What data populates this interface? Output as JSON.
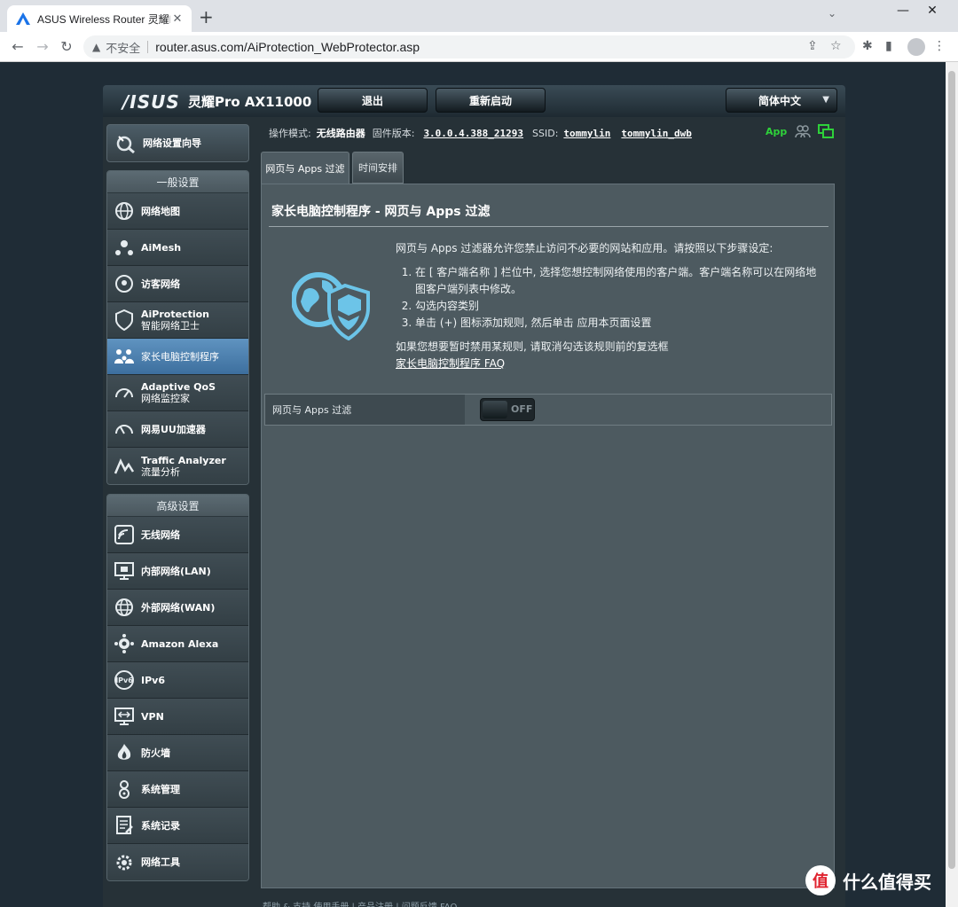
{
  "browser": {
    "tab_title": "ASUS Wireless Router 灵耀Pro",
    "tab_close": "✕",
    "new_tab": "+",
    "insecure_label": "不安全",
    "url": "router.asus.com/AiProtection_WebProtector.asp"
  },
  "header": {
    "logo": "/ISUS",
    "model": "灵耀Pro AX11000",
    "logout": "退出",
    "reboot": "重新启动",
    "language": "简体中文"
  },
  "status": {
    "mode_label": "操作模式:",
    "mode_value": "无线路由器",
    "firmware_label": "固件版本:",
    "firmware_value": "3.0.0.4.388_21293",
    "ssid_label": "SSID:",
    "ssid_1": "tommylin",
    "ssid_2": "tommylin_dwb",
    "app_label": "App"
  },
  "sidebar": {
    "qis": "网络设置向导",
    "general_title": "一般设置",
    "general": [
      {
        "label": "网络地图",
        "sub": "",
        "icon": "globe-icon"
      },
      {
        "label": "AiMesh",
        "sub": "",
        "icon": "mesh-icon"
      },
      {
        "label": "访客网络",
        "sub": "",
        "icon": "guest-network-icon"
      },
      {
        "label": "AiProtection",
        "sub": "智能网络卫士",
        "icon": "shield-icon"
      },
      {
        "label": "家长电脑控制程序",
        "sub": "",
        "icon": "family-icon"
      },
      {
        "label": "Adaptive QoS",
        "sub": "网络监控家",
        "icon": "gauge-icon"
      },
      {
        "label": "网易UU加速器",
        "sub": "",
        "icon": "speed-icon"
      },
      {
        "label": "Traffic Analyzer",
        "sub": "流量分析",
        "icon": "chart-icon"
      }
    ],
    "advanced_title": "高级设置",
    "advanced": [
      {
        "label": "无线网络",
        "icon": "wifi-icon"
      },
      {
        "label": "内部网络(LAN)",
        "icon": "lan-icon"
      },
      {
        "label": "外部网络(WAN)",
        "icon": "wan-icon"
      },
      {
        "label": "Amazon Alexa",
        "icon": "alexa-icon"
      },
      {
        "label": "IPv6",
        "icon": "ipv6-icon"
      },
      {
        "label": "VPN",
        "icon": "vpn-icon"
      },
      {
        "label": "防火墙",
        "icon": "firewall-icon"
      },
      {
        "label": "系统管理",
        "icon": "admin-icon"
      },
      {
        "label": "系统记录",
        "icon": "log-icon"
      },
      {
        "label": "网络工具",
        "icon": "tools-icon"
      }
    ]
  },
  "tabs": {
    "web_apps": "网页与 Apps 过滤",
    "schedule": "时间安排"
  },
  "panel": {
    "title": "家长电脑控制程序 - 网页与 Apps 过滤",
    "intro": "网页与 Apps 过滤器允许您禁止访问不必要的网站和应用。请按照以下步骤设定:",
    "steps": [
      "在 [ 客户端名称 ] 栏位中, 选择您想控制网络使用的客户端。客户端名称可以在网络地图客户端列表中修改。",
      "勾选内容类别",
      "单击 (+) 图标添加规则, 然后单击 应用本页面设置"
    ],
    "note": "如果您想要暂时禁用某规则, 请取消勾选该规则前的复选框",
    "faq": "家长电脑控制程序 FAQ",
    "toggle_label": "网页与 Apps 过滤",
    "toggle_state": "OFF"
  },
  "footer": {
    "text": "帮助 & 支持   使用手册 | 产品注册 | 问题反馈        FAQ"
  },
  "watermark": {
    "logo": "值",
    "text": "什么值得买"
  },
  "colors": {
    "active_item": "#4f83b3",
    "app_green": "#2ed13a",
    "panel_bg": "#4d5a60"
  }
}
